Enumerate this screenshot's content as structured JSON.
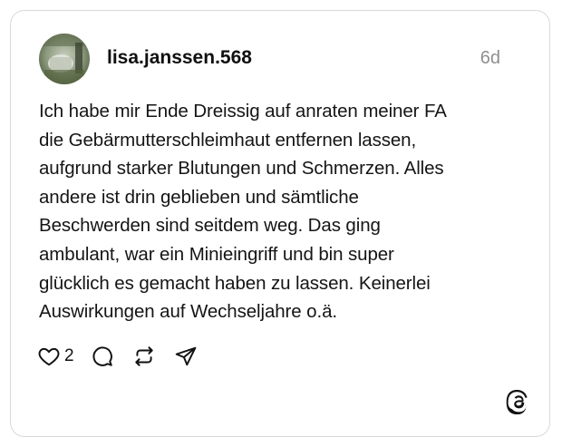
{
  "post": {
    "username": "lisa.janssen.568",
    "time": "6d",
    "text_lines": [
      "Ich habe mir Ende Dreissig auf anraten meiner FA",
      "die Gebärmutterschleimhaut entfernen lassen,",
      "aufgrund starker Blutungen und Schmerzen. Alles",
      "andere ist drin geblieben und sämtliche",
      "Beschwerden sind seitdem weg. Das ging",
      "ambulant, war ein Minieingriff und bin super",
      "glücklich es gemacht haben zu lassen. Keinerlei",
      "Auswirkungen auf Wechseljahre o.ä."
    ]
  },
  "actions": {
    "like_count": "2",
    "icons": [
      "heart-icon",
      "comment-icon",
      "repost-icon",
      "share-icon"
    ]
  },
  "branding": {
    "logo": "threads-logo-icon"
  },
  "colors": {
    "text": "#151515",
    "muted": "#8f8f8f",
    "border": "#d9d9d9",
    "background": "#ffffff"
  }
}
